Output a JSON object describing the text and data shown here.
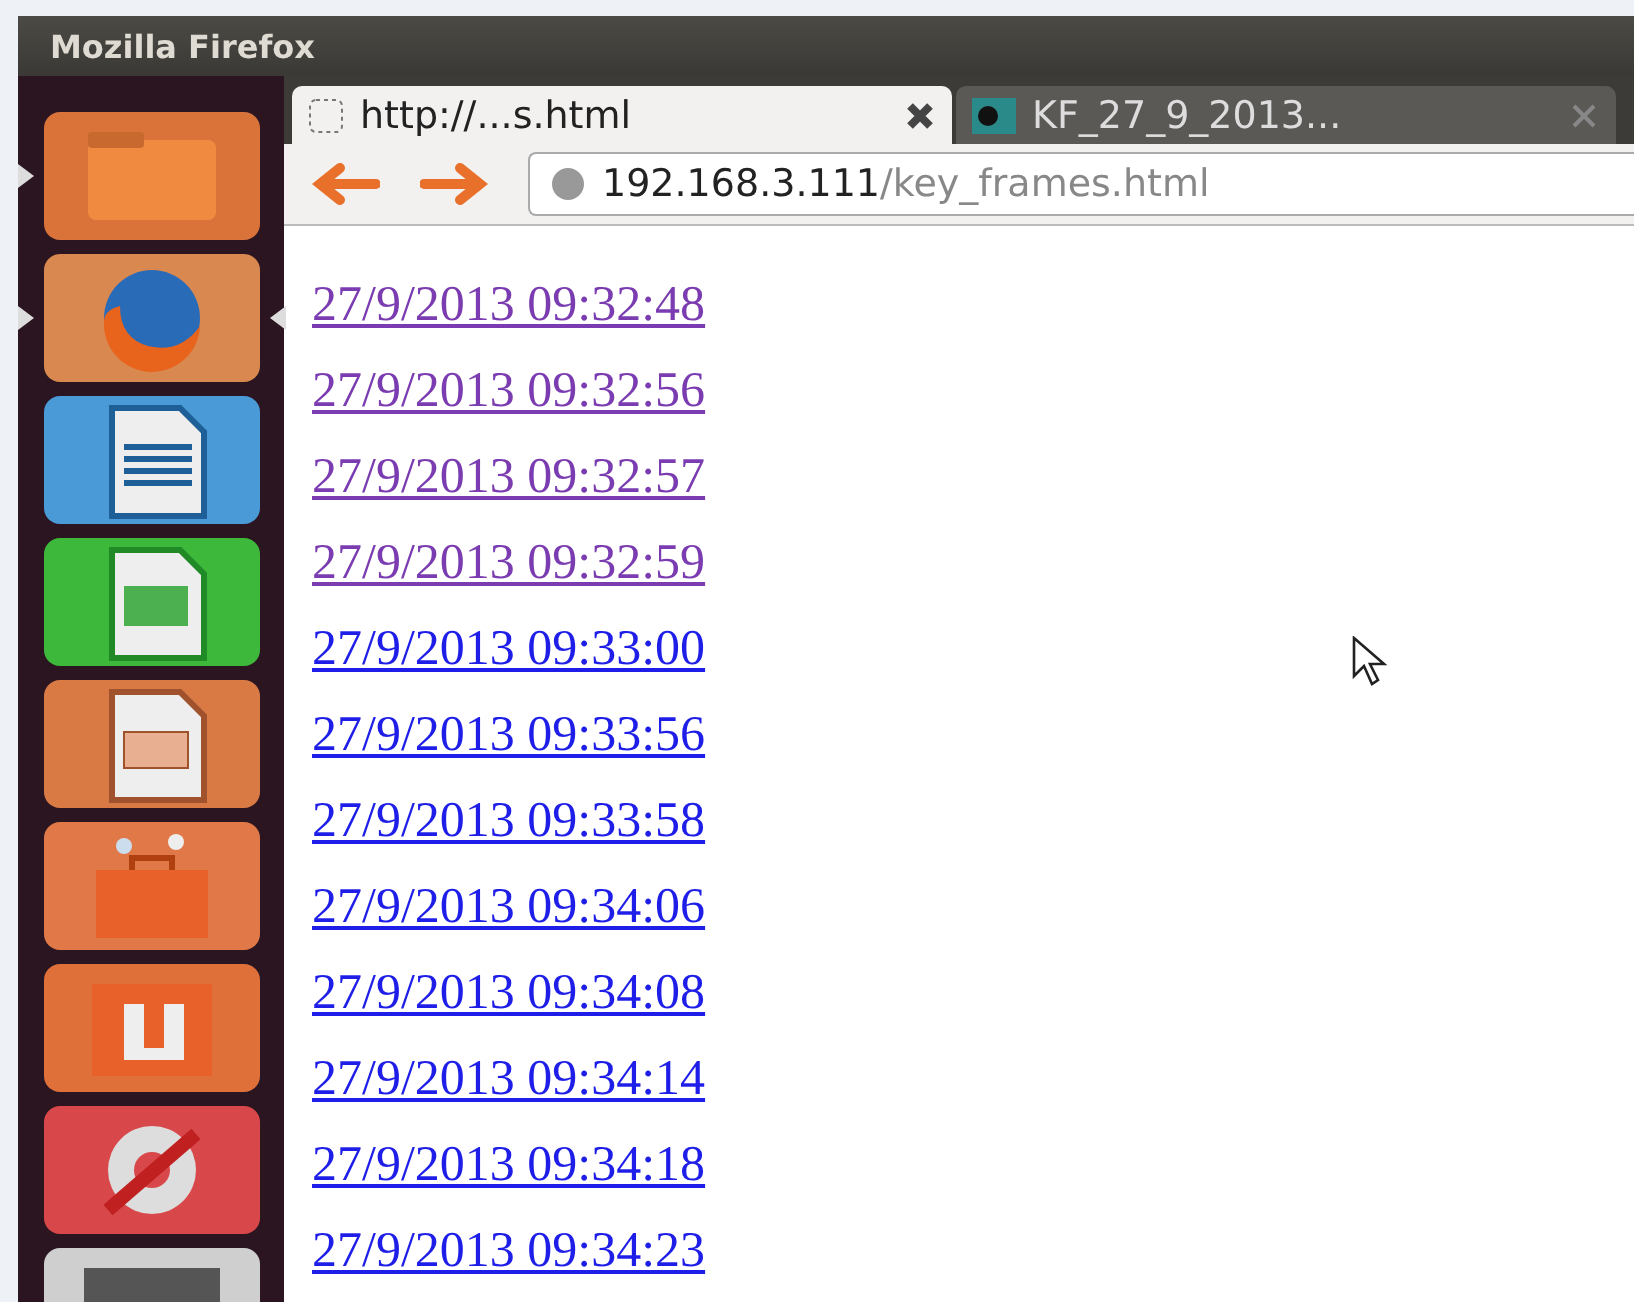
{
  "window": {
    "title": "Mozilla Firefox"
  },
  "launcher": [
    {
      "kind": "folder",
      "running": true,
      "focused": false
    },
    {
      "kind": "firefox",
      "running": true,
      "focused": true
    },
    {
      "kind": "writer",
      "running": false,
      "focused": false
    },
    {
      "kind": "calc",
      "running": false,
      "focused": false
    },
    {
      "kind": "impress",
      "running": false,
      "focused": false
    },
    {
      "kind": "store",
      "running": false,
      "focused": false
    },
    {
      "kind": "ubuntuone",
      "running": false,
      "focused": false
    },
    {
      "kind": "settings",
      "running": false,
      "focused": false
    },
    {
      "kind": "partial",
      "running": false,
      "focused": false
    }
  ],
  "tabs": [
    {
      "label": "http://...s.html",
      "selected": true
    },
    {
      "label": "KF_27_9_2013...",
      "selected": false
    }
  ],
  "address_bar": {
    "host": "192.168.3.111",
    "path": "/key_frames.html"
  },
  "links": [
    {
      "text": "27/9/2013 09:32:48",
      "visited": true
    },
    {
      "text": "27/9/2013 09:32:56",
      "visited": true
    },
    {
      "text": "27/9/2013 09:32:57",
      "visited": true
    },
    {
      "text": "27/9/2013 09:32:59",
      "visited": true
    },
    {
      "text": "27/9/2013 09:33:00",
      "visited": false
    },
    {
      "text": "27/9/2013 09:33:56",
      "visited": false
    },
    {
      "text": "27/9/2013 09:33:58",
      "visited": false
    },
    {
      "text": "27/9/2013 09:34:06",
      "visited": false
    },
    {
      "text": "27/9/2013 09:34:08",
      "visited": false
    },
    {
      "text": "27/9/2013 09:34:14",
      "visited": false
    },
    {
      "text": "27/9/2013 09:34:18",
      "visited": false
    },
    {
      "text": "27/9/2013 09:34:23",
      "visited": false
    }
  ]
}
